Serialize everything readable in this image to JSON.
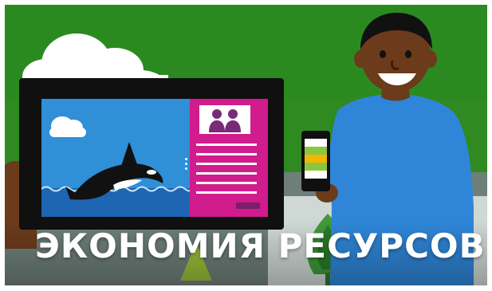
{
  "banner": {
    "title": "ЭКОНОМИЯ РЕСУРСОВ"
  },
  "colors": {
    "background_green": "#2f8a22",
    "shirt_blue": "#2f86d8",
    "tablet_black": "#101010",
    "screen_blue": "#2f8fd7",
    "screen_magenta": "#d01c8c",
    "text_white": "#ffffff"
  },
  "icons": {
    "cloud": "cloud-icon",
    "orca": "orca-icon",
    "people": "people-icon",
    "tree": "tree-icon",
    "phone": "phone-icon"
  }
}
